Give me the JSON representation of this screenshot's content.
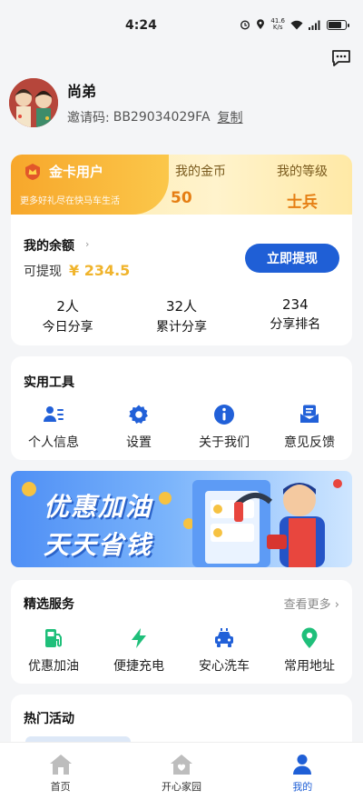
{
  "status_bar": {
    "time": "4:24",
    "net_speed_value": "41.6",
    "net_speed_unit": "K/s"
  },
  "profile": {
    "name": "尚弟",
    "invite_label": "邀请码:",
    "invite_code": "BB29034029FA",
    "copy_label": "复制"
  },
  "vip": {
    "title": "金卡用户",
    "subtitle": "更多好礼尽在快马车生活",
    "coins_label": "我的金币",
    "coins_value": "50",
    "level_label": "我的等级",
    "level_value": "士兵"
  },
  "balance": {
    "title": "我的余额",
    "withdrawable_label": "可提现",
    "amount": "¥ 234.5",
    "withdraw_button": "立即提现",
    "stats": [
      {
        "value": "2人",
        "label": "今日分享"
      },
      {
        "value": "32人",
        "label": "累计分享"
      },
      {
        "value": "234",
        "label": "分享排名"
      }
    ]
  },
  "tools": {
    "title": "实用工具",
    "items": [
      {
        "label": "个人信息",
        "icon": "user-card-icon"
      },
      {
        "label": "设置",
        "icon": "gear-icon"
      },
      {
        "label": "关于我们",
        "icon": "info-icon"
      },
      {
        "label": "意见反馈",
        "icon": "feedback-icon"
      }
    ]
  },
  "banner": {
    "line1": "优惠加油",
    "line2": "天天省钱"
  },
  "services": {
    "title": "精选服务",
    "see_more": "查看更多 ›",
    "items": [
      {
        "label": "优惠加油",
        "icon": "fuel-pump-icon"
      },
      {
        "label": "便捷充电",
        "icon": "lightning-icon"
      },
      {
        "label": "安心洗车",
        "icon": "car-icon"
      },
      {
        "label": "常用地址",
        "icon": "location-pin-icon"
      }
    ]
  },
  "activities": {
    "title": "热门活动"
  },
  "tabbar": {
    "tabs": [
      {
        "label": "首页",
        "icon": "home-icon"
      },
      {
        "label": "开心家园",
        "icon": "house-heart-icon"
      },
      {
        "label": "我的",
        "icon": "person-icon"
      }
    ]
  },
  "colors": {
    "primary": "#1f5fd6",
    "gold": "#f0b42c",
    "accent_orange": "#e57e13",
    "icon_blue": "#2160d8",
    "icon_green": "#1fbf7a"
  }
}
